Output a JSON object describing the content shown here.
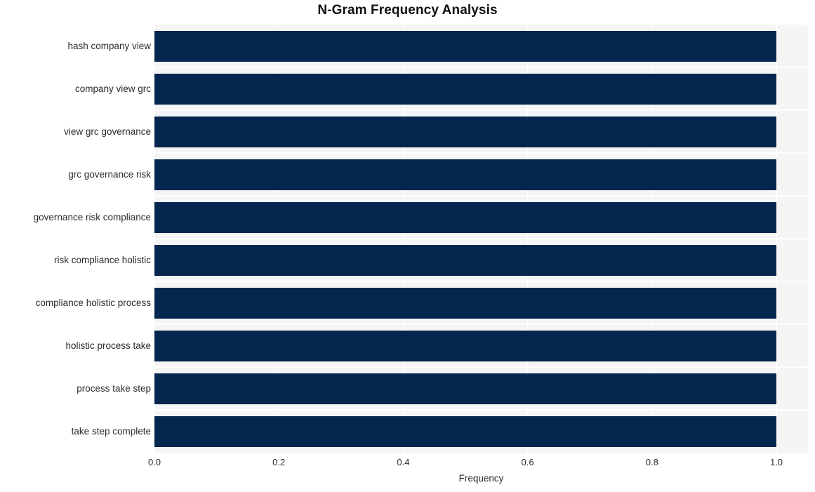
{
  "chart_data": {
    "type": "bar",
    "orientation": "horizontal",
    "title": "N-Gram Frequency Analysis",
    "xlabel": "Frequency",
    "ylabel": "",
    "xlim": [
      0.0,
      1.0
    ],
    "xticks": [
      "0.0",
      "0.2",
      "0.4",
      "0.6",
      "0.8",
      "1.0"
    ],
    "xtick_values": [
      0.0,
      0.2,
      0.4,
      0.6,
      0.8,
      1.0
    ],
    "grid": true,
    "legend": "none",
    "categories": [
      "hash company view",
      "company view grc",
      "view grc governance",
      "grc governance risk",
      "governance risk compliance",
      "risk compliance holistic",
      "compliance holistic process",
      "holistic process take",
      "process take step",
      "take step complete"
    ],
    "values": [
      1.0,
      1.0,
      1.0,
      1.0,
      1.0,
      1.0,
      1.0,
      1.0,
      1.0,
      1.0
    ],
    "bar_color": "#04264f",
    "plot_background": "#f5f5f5",
    "grid_color": "#ffffff",
    "figure_background": "#ffffff"
  }
}
